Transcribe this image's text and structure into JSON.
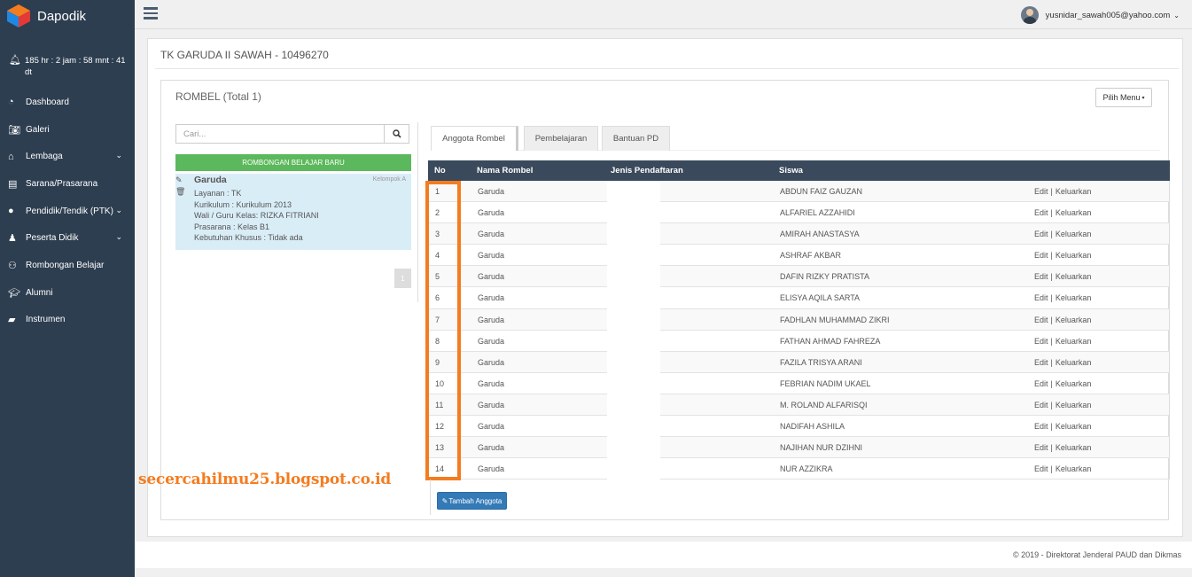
{
  "app": {
    "name": "Dapodik"
  },
  "sidebar": {
    "timer": "185 hr : 2 jam : 58 mnt : 41 dt",
    "items": [
      {
        "label": "Dashboard",
        "icon": "dashboard-icon",
        "caret": false
      },
      {
        "label": "Galeri",
        "icon": "camera-icon",
        "caret": false
      },
      {
        "label": "Lembaga",
        "icon": "home-icon",
        "caret": true
      },
      {
        "label": "Sarana/Prasarana",
        "icon": "building-icon",
        "caret": false
      },
      {
        "label": "Pendidik/Tendik (PTK)",
        "icon": "user-icon",
        "caret": true
      },
      {
        "label": "Peserta Didik",
        "icon": "student-icon",
        "caret": true
      },
      {
        "label": "Rombongan Belajar",
        "icon": "group-icon",
        "caret": false
      },
      {
        "label": "Alumni",
        "icon": "graduation-cap-icon",
        "caret": false
      },
      {
        "label": "Instrumen",
        "icon": "folder-icon",
        "caret": false
      }
    ]
  },
  "header": {
    "user_email": "yusnidar_sawah005@yahoo.com"
  },
  "page": {
    "school": "TK GARUDA II SAWAH - 10496270",
    "rombel_title": "ROMBEL (Total 1)",
    "pilih_menu": "Pilih Menu",
    "search_placeholder": "Cari...",
    "new_button": "ROMBONGAN BELAJAR BARU",
    "card": {
      "name": "Garuda",
      "kelompok": "Kelompok A",
      "layanan": "Layanan : TK",
      "kurikulum": "Kurikulum : Kurikulum 2013",
      "wali": "Wali / Guru Kelas: RIZKA FITRIANI",
      "prasarana": "Prasarana : Kelas B1",
      "kebutuhan": "Kebutuhan Khusus : Tidak ada"
    },
    "page_number": "1",
    "tabs": [
      "Anggota Rombel",
      "Pembelajaran",
      "Bantuan PD"
    ],
    "table": {
      "headers": {
        "no": "No",
        "nama": "Nama Rombel",
        "jenis": "Jenis Pendaftaran",
        "siswa": "Siswa"
      },
      "rows": [
        {
          "no": "1",
          "nama": "Garuda",
          "siswa": "ABDUN FAIZ GAUZAN"
        },
        {
          "no": "2",
          "nama": "Garuda",
          "siswa": "ALFARIEL AZZAHIDI"
        },
        {
          "no": "3",
          "nama": "Garuda",
          "siswa": "AMIRAH ANASTASYA"
        },
        {
          "no": "4",
          "nama": "Garuda",
          "siswa": "ASHRAF AKBAR"
        },
        {
          "no": "5",
          "nama": "Garuda",
          "siswa": "DAFIN RIZKY PRATISTA"
        },
        {
          "no": "6",
          "nama": "Garuda",
          "siswa": "ELISYA AQILA SARTA"
        },
        {
          "no": "7",
          "nama": "Garuda",
          "siswa": "FADHLAN MUHAMMAD ZIKRI"
        },
        {
          "no": "8",
          "nama": "Garuda",
          "siswa": "FATHAN AHMAD FAHREZA"
        },
        {
          "no": "9",
          "nama": "Garuda",
          "siswa": "FAZILA TRISYA ARANI"
        },
        {
          "no": "10",
          "nama": "Garuda",
          "siswa": "FEBRIAN NADIM UKAEL"
        },
        {
          "no": "11",
          "nama": "Garuda",
          "siswa": "M. ROLAND ALFARISQI"
        },
        {
          "no": "12",
          "nama": "Garuda",
          "siswa": "NADIFAH ASHILA"
        },
        {
          "no": "13",
          "nama": "Garuda",
          "siswa": "NAJIHAN NUR DZIHNI"
        },
        {
          "no": "14",
          "nama": "Garuda",
          "siswa": "NUR AZZIKRA"
        }
      ],
      "edit_label": "Edit",
      "separator": "|",
      "keluarkan_label": "Keluarkan"
    },
    "tambah_button": "Tambah Anggota"
  },
  "watermark": "secercahilmu25.blogspot.co.id",
  "footer": "©   2019 - Direktorat Jenderal PAUD dan Dikmas",
  "colors": {
    "sidebar": "#2d3e50",
    "green": "#5cb85c",
    "blue": "#337ab7",
    "highlight": "#f47c20",
    "table_header": "#3a4a5c"
  }
}
